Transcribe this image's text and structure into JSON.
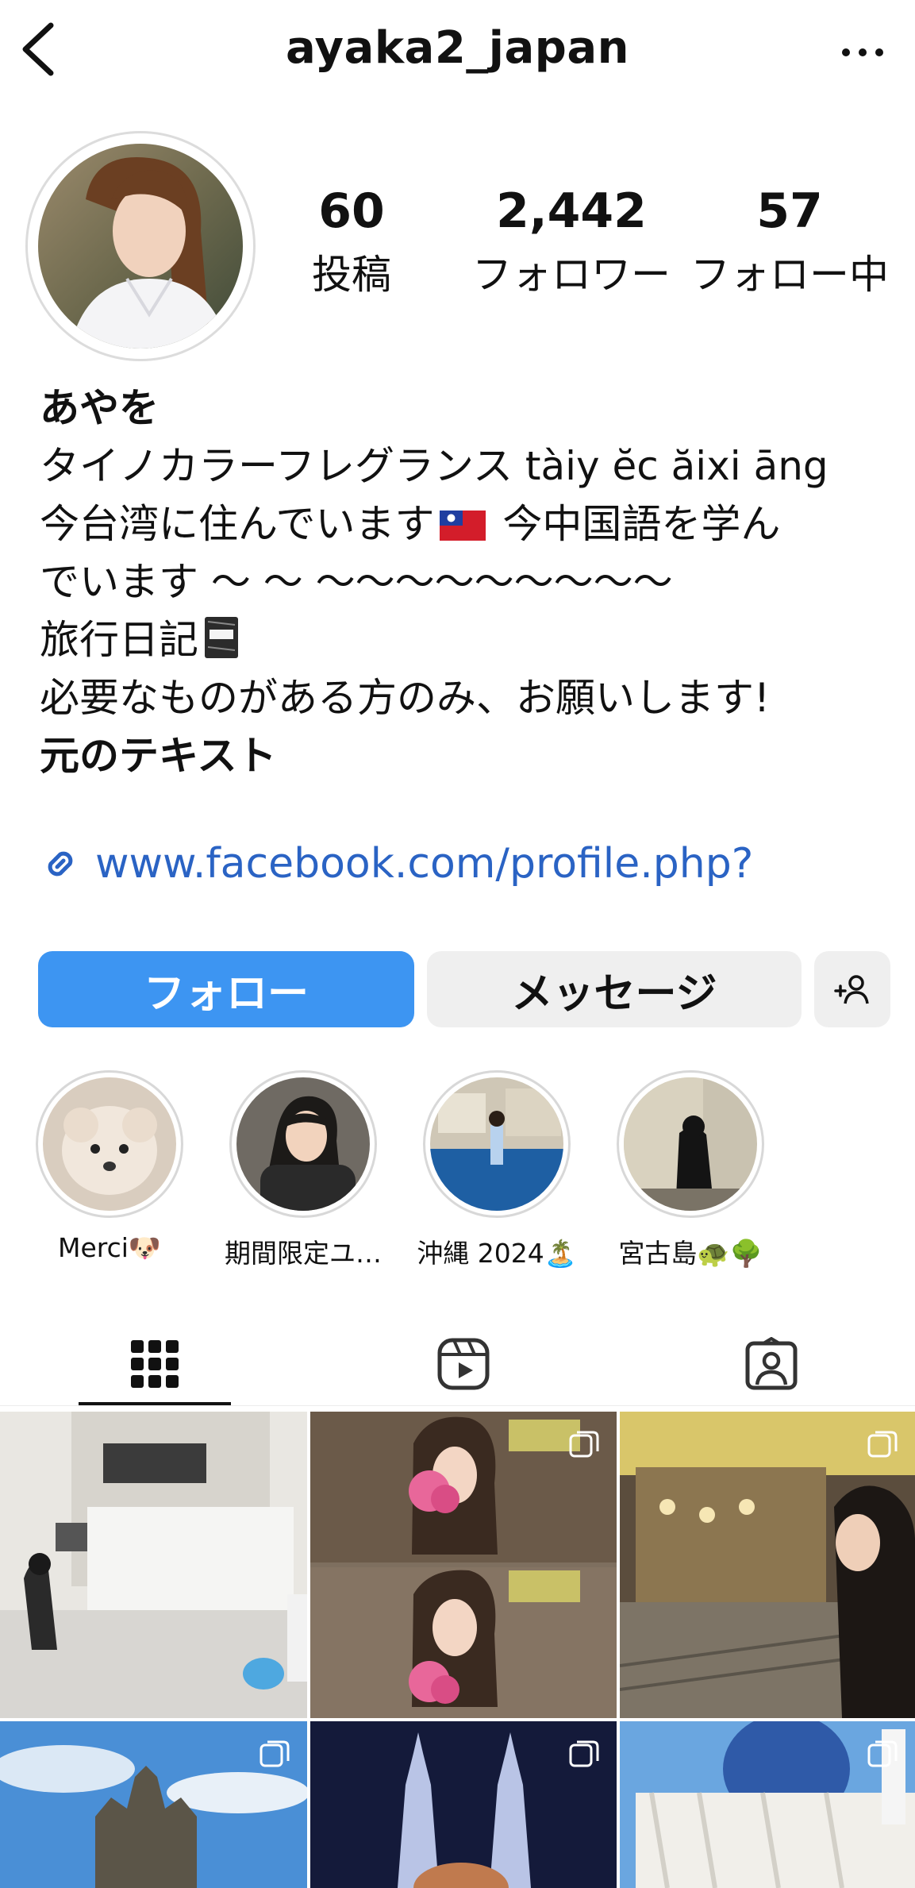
{
  "header": {
    "username": "ayaka2_japan"
  },
  "stats": [
    {
      "value": "60",
      "label": "投稿"
    },
    {
      "value": "2,442",
      "label": "フォロワー"
    },
    {
      "value": "57",
      "label": "フォロー中"
    }
  ],
  "bio": {
    "name": "あやを",
    "line1": "タイノカラーフレグランス tàiy ĕc ăixi āng",
    "line2a": "今台湾に住んでいます",
    "line2b": "今中国語を学ん",
    "line3": "でいます ～ ～ ～～～～～～～～～",
    "line4": "旅行日記",
    "line5": "必要なものがある方のみ、お願いします!",
    "line6": "元のテキスト",
    "link": "www.facebook.com/profile.php?"
  },
  "buttons": {
    "follow": "フォロー",
    "message": "メッセージ"
  },
  "highlights": [
    {
      "label": "Merci🐶"
    },
    {
      "label": "期間限定ユ…"
    },
    {
      "label": "沖縄 2024🏝️"
    },
    {
      "label": "宮古島🐢🌳"
    }
  ],
  "tabs": [
    {
      "icon": "grid-icon"
    },
    {
      "icon": "reels-icon"
    },
    {
      "icon": "tagged-icon"
    }
  ],
  "colors": {
    "accent": "#3d95f2",
    "link": "#2a63c4"
  }
}
